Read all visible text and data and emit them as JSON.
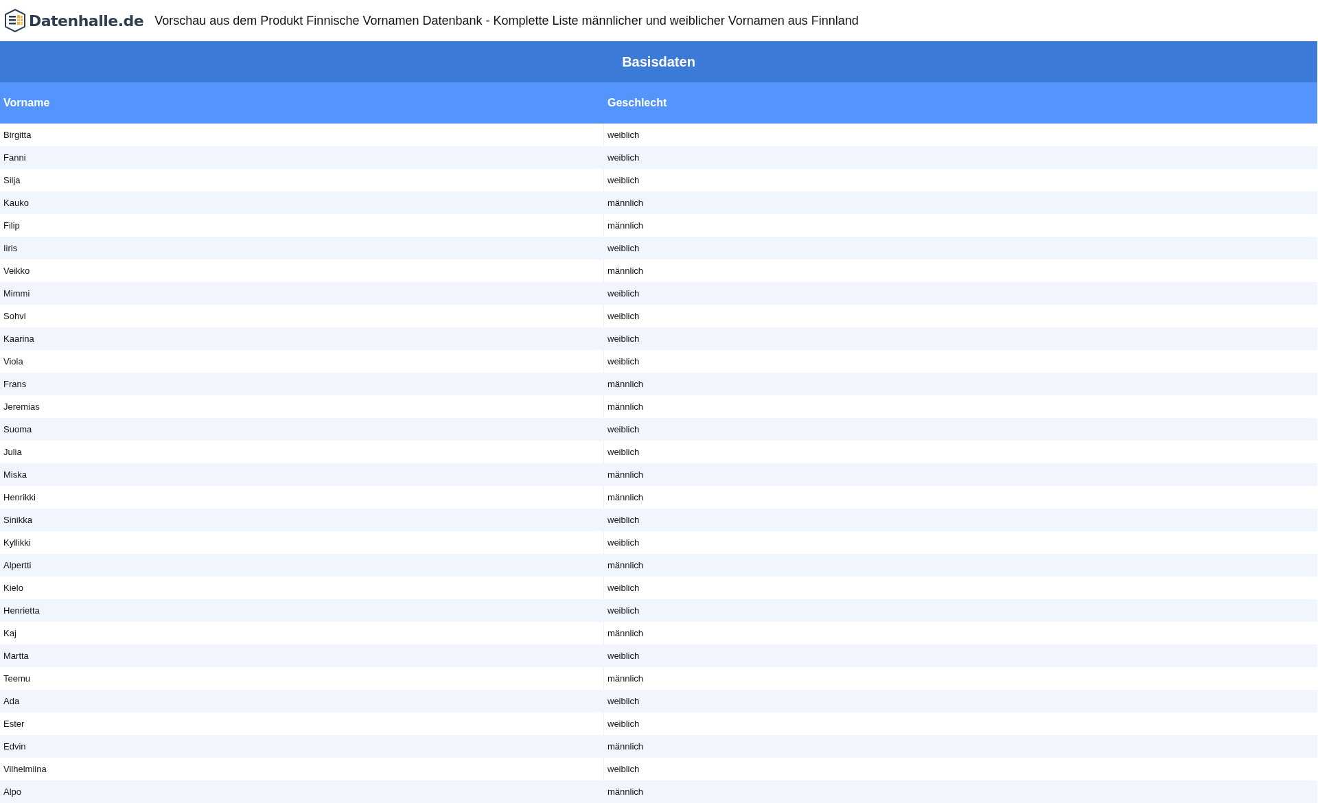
{
  "header": {
    "logo_text": "Datenhalle.de",
    "title": "Vorschau aus dem Produkt Finnische Vornamen Datenbank - Komplette Liste männlicher und weiblicher Vornamen aus Finnland"
  },
  "table": {
    "group_heading": "Basisdaten",
    "columns": [
      "Vorname",
      "Geschlecht"
    ],
    "rows": [
      [
        "Birgitta",
        "weiblich"
      ],
      [
        "Fanni",
        "weiblich"
      ],
      [
        "Silja",
        "weiblich"
      ],
      [
        "Kauko",
        "männlich"
      ],
      [
        "Filip",
        "männlich"
      ],
      [
        "Iiris",
        "weiblich"
      ],
      [
        "Veikko",
        "männlich"
      ],
      [
        "Mimmi",
        "weiblich"
      ],
      [
        "Sohvi",
        "weiblich"
      ],
      [
        "Kaarina",
        "weiblich"
      ],
      [
        "Viola",
        "weiblich"
      ],
      [
        "Frans",
        "männlich"
      ],
      [
        "Jeremias",
        "männlich"
      ],
      [
        "Suoma",
        "weiblich"
      ],
      [
        "Julia",
        "weiblich"
      ],
      [
        "Miska",
        "männlich"
      ],
      [
        "Henrikki",
        "männlich"
      ],
      [
        "Sinikka",
        "weiblich"
      ],
      [
        "Kyllikki",
        "weiblich"
      ],
      [
        "Alpertti",
        "männlich"
      ],
      [
        "Kielo",
        "weiblich"
      ],
      [
        "Henrietta",
        "weiblich"
      ],
      [
        "Kaj",
        "männlich"
      ],
      [
        "Martta",
        "weiblich"
      ],
      [
        "Teemu",
        "männlich"
      ],
      [
        "Ada",
        "weiblich"
      ],
      [
        "Ester",
        "weiblich"
      ],
      [
        "Edvin",
        "männlich"
      ],
      [
        "Vilhelmiina",
        "weiblich"
      ],
      [
        "Alpo",
        "männlich"
      ]
    ]
  }
}
